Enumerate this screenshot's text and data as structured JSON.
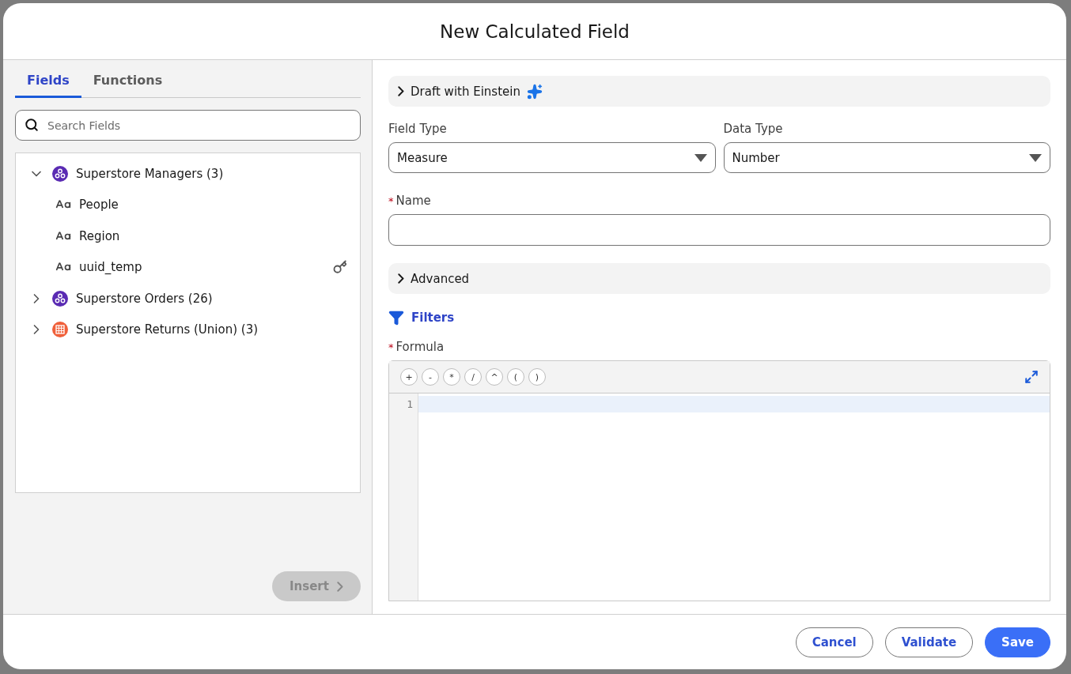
{
  "dialog": {
    "title": "New Calculated Field"
  },
  "tabs": [
    {
      "label": "Fields",
      "selected": true
    },
    {
      "label": "Functions",
      "selected": false
    }
  ],
  "search": {
    "placeholder": "Search Fields"
  },
  "tree": [
    {
      "label": "Superstore Managers (3)",
      "kind": "dataset",
      "expanded": true,
      "children": [
        {
          "label": "People",
          "has_key": false
        },
        {
          "label": "Region",
          "has_key": false
        },
        {
          "label": "uuid_temp",
          "has_key": true
        }
      ]
    },
    {
      "label": "Superstore Orders (26)",
      "kind": "dataset",
      "expanded": false
    },
    {
      "label": "Superstore Returns (Union) (3)",
      "kind": "union",
      "expanded": false
    }
  ],
  "insert_button": {
    "label": "Insert",
    "disabled": true
  },
  "einstein": {
    "label": "Draft with Einstein",
    "expanded": false
  },
  "field_type": {
    "label": "Field Type",
    "value": "Measure"
  },
  "data_type": {
    "label": "Data Type",
    "value": "Number"
  },
  "name": {
    "label": "Name",
    "required_mark": "*"
  },
  "advanced": {
    "label": "Advanced",
    "expanded": false
  },
  "filters": {
    "label": "Filters"
  },
  "formula": {
    "label": "Formula",
    "required_mark": "*",
    "operators": [
      "+",
      "-",
      "*",
      "/",
      "^",
      "(",
      ")"
    ],
    "line_numbers": [
      "1"
    ]
  },
  "buttons": [
    {
      "label": "Cancel",
      "kind": "outline"
    },
    {
      "label": "Validate",
      "kind": "outline"
    },
    {
      "label": "Save",
      "kind": "brand"
    }
  ]
}
